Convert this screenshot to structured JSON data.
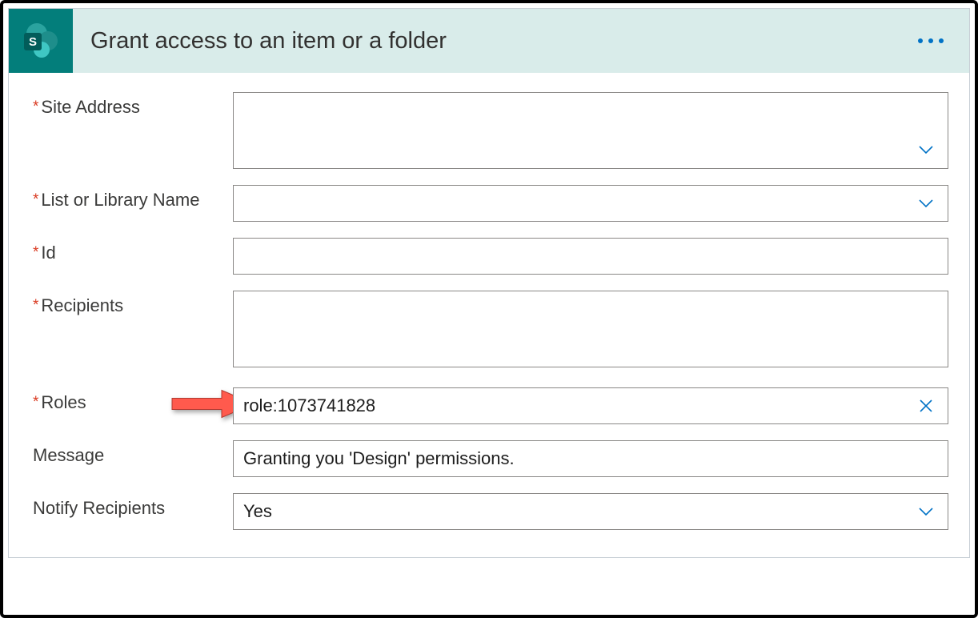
{
  "title": "Grant access to an item or a folder",
  "icon_letter": "S",
  "fields": {
    "site_address": {
      "label": "Site Address",
      "required": true,
      "value": ""
    },
    "list_name": {
      "label": "List or Library Name",
      "required": true,
      "value": ""
    },
    "id": {
      "label": "Id",
      "required": true,
      "value": ""
    },
    "recipients": {
      "label": "Recipients",
      "required": true,
      "value": ""
    },
    "roles": {
      "label": "Roles",
      "required": true,
      "value": "role:1073741828"
    },
    "message": {
      "label": "Message",
      "required": false,
      "value": "Granting you 'Design' permissions."
    },
    "notify": {
      "label": "Notify Recipients",
      "required": false,
      "value": "Yes"
    }
  }
}
